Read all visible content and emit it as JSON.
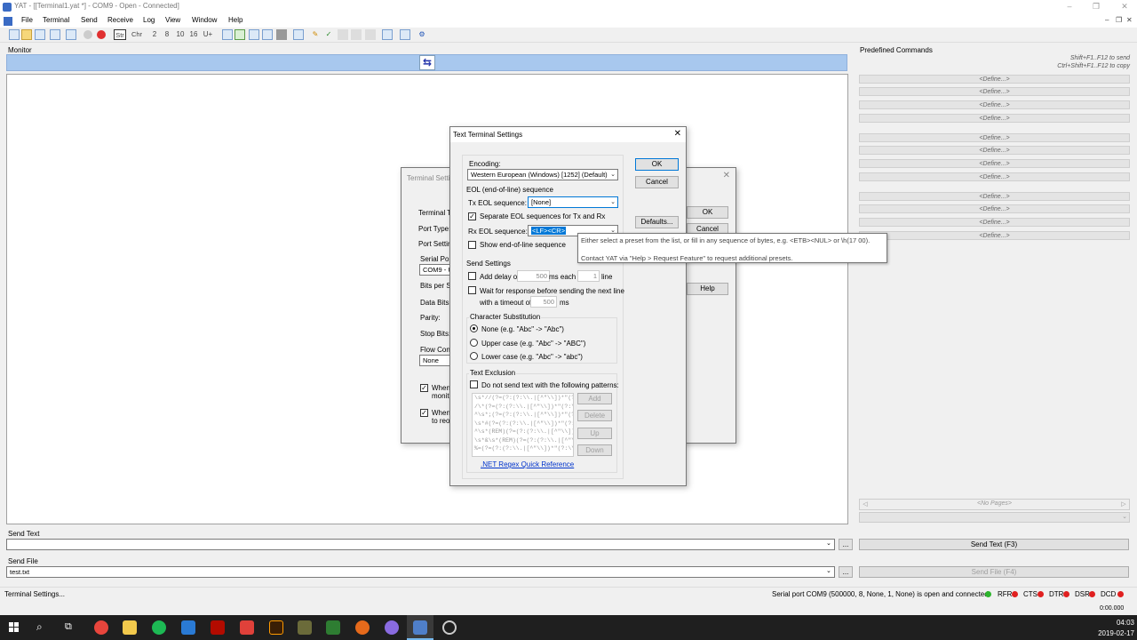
{
  "window": {
    "title": "YAT - [[Terminal1.yat *] - COM9 - Open - Connected]"
  },
  "menu": [
    "File",
    "Terminal",
    "Send",
    "Receive",
    "Log",
    "View",
    "Window",
    "Help"
  ],
  "toolbar": {
    "str": "Str",
    "chr": "Chr",
    "n2": "2",
    "n8": "8",
    "n10": "10",
    "n16": "16",
    "u": "U+"
  },
  "monitor": {
    "label": "Monitor"
  },
  "predef": {
    "label": "Predefined Commands",
    "hint1": "Shift+F1..F12 to send",
    "hint2": "Ctrl+Shift+F1..F12 to copy",
    "define": "<Define...>",
    "nopages": "<No Pages>"
  },
  "send_text": {
    "label": "Send Text",
    "value": "",
    "button": "Send Text (F3)",
    "browse": "..."
  },
  "send_file": {
    "label": "Send File",
    "value": "test.txt",
    "button": "Send File (F4)",
    "browse": "..."
  },
  "status": {
    "left": "Terminal Settings...",
    "right": "Serial port COM9 (500000, 8, None, 1, None) is open and connected",
    "rfr": "RFR",
    "cts": "CTS",
    "dtr": "DTR",
    "dsr": "DSR",
    "dcd": "DCD",
    "time": "0:00.000"
  },
  "bg_dialog": {
    "title": "Terminal Setti",
    "ok": "OK",
    "cancel": "Cancel",
    "help": "Help",
    "terminal_type": "Terminal Ty",
    "port_type": "Port Type:",
    "port_settings": "Port Setting",
    "serial_port": "Serial Port",
    "serial_port_value": "COM9 - U",
    "bits_per_sec": "Bits per Se",
    "data_bits": "Data Bits:",
    "parity": "Parity:",
    "stop_bits": "Stop Bits:",
    "flow_control": "Flow Contr",
    "flow_value": "None",
    "when1": "When",
    "when1b": "monito",
    "when2": "When",
    "when2b": "to reo"
  },
  "dialog": {
    "title": "Text Terminal Settings",
    "ok": "OK",
    "cancel": "Cancel",
    "defaults": "Defaults...",
    "encoding_label": "Encoding:",
    "encoding_value": "Western European (Windows) [1252] (Default)",
    "eol_group": "EOL (end-of-line) sequence",
    "tx_eol_label": "Tx EOL sequence:",
    "tx_eol_value": "[None]",
    "separate_eol": "Separate EOL sequences for Tx and Rx",
    "rx_eol_label": "Rx EOL sequence:",
    "rx_eol_value": "<LF><CR>",
    "show_eol": "Show end-of-line sequence",
    "send_settings": "Send Settings",
    "add_delay": "Add delay of",
    "delay_value": "500",
    "ms_each": "ms each",
    "line_value": "1",
    "line": "line",
    "wait_response": "Wait for response before sending the next line",
    "with_timeout": "with a timeout of",
    "timeout_value": "500",
    "ms": "ms",
    "char_subst": "Character Substitution",
    "none_opt": "None (e.g. \"Abc\" -> \"Abc\")",
    "upper_opt": "Upper case (e.g. \"Abc\" -> \"ABC\")",
    "lower_opt": "Lower case (e.g. \"Abc\" -> \"abc\")",
    "text_exclusion": "Text Exclusion",
    "do_not_send": "Do not send text with the following patterns:",
    "patterns": [
      "\\s*//(?=(?:(?:\\\\.|[^\"\\\\])*\"(?:\\\\.|[^\"\\\\",
      "/\\*(?=(?:(?:\\\\.|[^\"\\\\])*\"(?:\\\\.|[^\"\\\\])",
      "^\\s*;(?=(?:(?:\\\\.|[^\"\\\\])*\"(?:\\\\.|[^\"",
      "\\s*#(?=(?:(?:\\\\.|[^\"\\\\])*\"(?:\\\\.|[^\"\\\\",
      "^\\s*(REM)(?=(?:(?:\\\\.|[^\"\\\\])*\"(?:",
      "\\s*&\\s*(REM)(?=(?:(?:\\\\.|[^\"\\\\])*\"",
      "%=(?=(?:(?:\\\\.|[^\"\\\\])*\"(?:\\\\.|[^\"\\\\])"
    ],
    "add": "Add",
    "delete": "Delete",
    "up": "Up",
    "down": "Down",
    "regex_link": ".NET Regex Quick Reference"
  },
  "tooltip": {
    "line1": "Either select a preset from the list, or fill in any sequence of bytes, e.g. <ETB><NUL> or \\h(17 00).",
    "line2": "Contact YAT via \"Help > Request Feature\" to request additional presets."
  },
  "tray": {
    "time": "04:03",
    "date": "2019-02-17"
  },
  "colors": {
    "monitor_bar": "#a8c8ee",
    "led_green": "#2db52d",
    "led_red": "#e02020",
    "link": "#0033cc"
  }
}
